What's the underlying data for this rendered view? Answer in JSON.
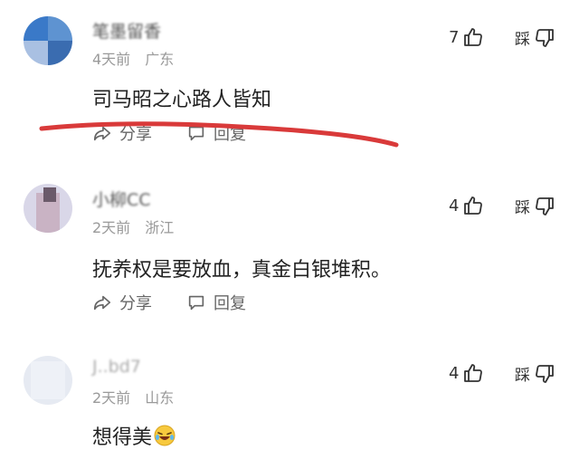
{
  "comments": [
    {
      "username": "笔墨留香",
      "time": "4天前",
      "location": "广东",
      "text": "司马昭之心路人皆知",
      "likes": "7",
      "dislike_label": "踩",
      "share_label": "分享",
      "reply_label": "回复"
    },
    {
      "username": "小柳CC",
      "time": "2天前",
      "location": "浙江",
      "text": "抚养权是要放血，真金白银堆积。",
      "likes": "4",
      "dislike_label": "踩",
      "share_label": "分享",
      "reply_label": "回复"
    },
    {
      "username": "J..bd7",
      "time": "2天前",
      "location": "山东",
      "text": "想得美",
      "likes": "4",
      "dislike_label": "踩"
    }
  ],
  "annotation": {
    "color": "#d93a3a"
  },
  "colors": {
    "meta": "#9a9a9a",
    "text": "#222222",
    "action": "#666666"
  }
}
